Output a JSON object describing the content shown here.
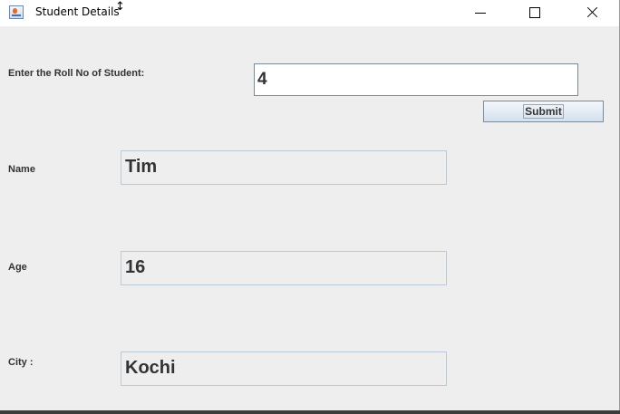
{
  "window": {
    "title": "Student Details",
    "icon": "java-app-icon"
  },
  "titlebar_buttons": [
    "minimize-icon",
    "maximize-icon",
    "close-icon"
  ],
  "form": {
    "roll_label": "Enter the Roll No of Student:",
    "roll_value": "4",
    "submit_label": "Submit"
  },
  "details": {
    "name_label": "Name",
    "name_value": "Tim",
    "age_label": "Age",
    "age_value": "16",
    "city_label": "City :",
    "city_value": "Kochi"
  },
  "colors": {
    "background": "#eeeeee",
    "input_border": "#7a8a99",
    "readonly_border": "#b9c9d8",
    "text": "#333333"
  }
}
